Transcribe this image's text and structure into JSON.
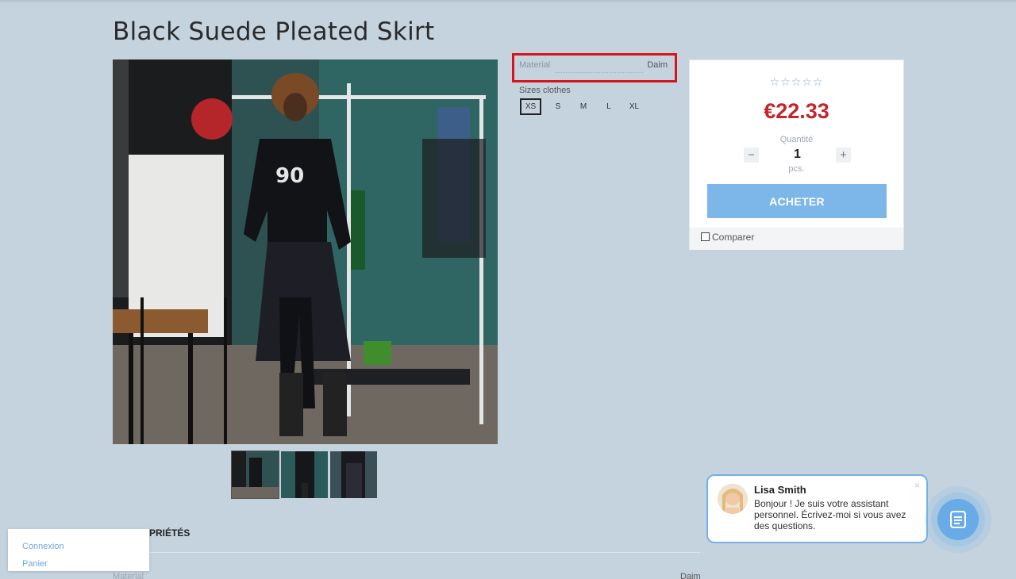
{
  "product": {
    "title": "Black Suede Pleated Skirt",
    "price": "€22.33",
    "stars": "☆☆☆☆☆"
  },
  "properties_panel": {
    "material_label": "Material",
    "material_value": "Daim",
    "sizes_label": "Sizes clothes",
    "sizes": [
      "XS",
      "S",
      "M",
      "L",
      "XL"
    ],
    "selected_size": "XS"
  },
  "buybox": {
    "quantity_label": "Quantité",
    "quantity_value": "1",
    "unit": "pcs.",
    "minus": "−",
    "plus": "+",
    "buy_label": "ACHETER",
    "compare_label": "Comparer"
  },
  "section": {
    "heading": "PRIÉTÉS",
    "material_label": "Material",
    "material_value": "Daim"
  },
  "account_menu": {
    "login": "Connexion",
    "cart": "Panier"
  },
  "chat": {
    "name": "Lisa Smith",
    "message": "Bonjour ! Je suis votre assistant personnel. Écrivez-moi si vous avez des questions.",
    "close": "×"
  },
  "colors": {
    "background": "#c5d3df",
    "price": "#c4242b",
    "buy_button": "#7db7ea",
    "highlight_border": "#d7141c",
    "chat_accent": "#69abe6"
  }
}
